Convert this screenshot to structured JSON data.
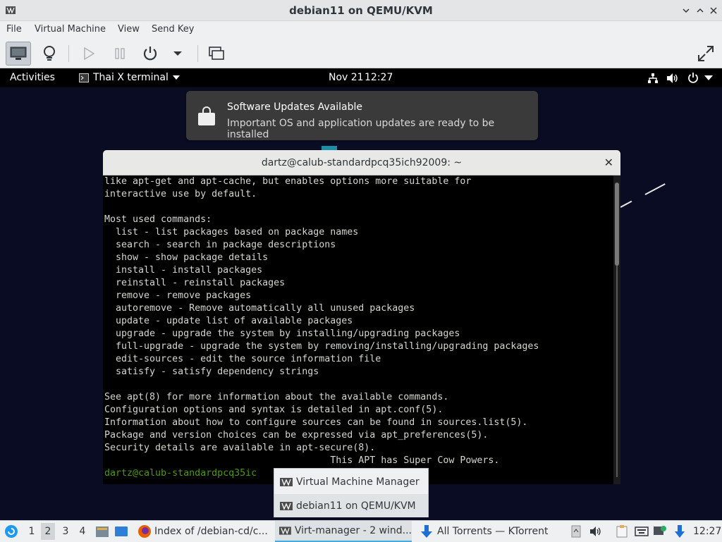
{
  "window": {
    "title": "debian11 on QEMU/KVM",
    "app_icon": "virt-manager-icon",
    "buttons": [
      "minimize-icon",
      "maximize-icon",
      "close-icon"
    ]
  },
  "menu": {
    "items": [
      "File",
      "Virtual Machine",
      "View",
      "Send Key"
    ]
  },
  "toolbar": {
    "buttons": [
      {
        "name": "console-icon",
        "active": true
      },
      {
        "name": "lightbulb-icon",
        "active": false
      },
      {
        "name": "play-icon",
        "active": false
      },
      {
        "name": "pause-icon",
        "active": false
      },
      {
        "name": "power-icon",
        "active": false
      },
      {
        "name": "chevron-down-icon",
        "active": false
      },
      {
        "name": "screenshot-icon",
        "active": false
      },
      {
        "name": "fullscreen-icon",
        "active": false
      }
    ]
  },
  "gnome": {
    "activities": "Activities",
    "app_menu": "Thai X terminal",
    "date": "Nov 21",
    "time": "12:27"
  },
  "notification": {
    "title": "Software Updates Available",
    "body": "Important OS and application updates are ready to be installed"
  },
  "terminal": {
    "title": "dartz@calub-standardpcq35ich92009: ~",
    "lines": [
      "like apt-get and apt-cache, but enables options more suitable for",
      "interactive use by default.",
      "",
      "Most used commands:",
      "  list - list packages based on package names",
      "  search - search in package descriptions",
      "  show - show package details",
      "  install - install packages",
      "  reinstall - reinstall packages",
      "  remove - remove packages",
      "  autoremove - Remove automatically all unused packages",
      "  update - update list of available packages",
      "  upgrade - upgrade the system by installing/upgrading packages",
      "  full-upgrade - upgrade the system by removing/installing/upgrading packages",
      "  edit-sources - edit the source information file",
      "  satisfy - satisfy dependency strings",
      "",
      "See apt(8) for more information about the available commands.",
      "Configuration options and syntax is detailed in apt.conf(5).",
      "Information about how to configure sources can be found in sources.list(5).",
      "Package and version choices can be expressed via apt_preferences(5).",
      "Security details are available in apt-secure(8).",
      "                                        This APT has Super Cow Powers."
    ],
    "prompt": "dartz@calub-standardpcq35ic"
  },
  "popup": {
    "items": [
      "Virtual Machine Manager",
      "debian11 on QEMU/KVM"
    ]
  },
  "taskbar": {
    "desktops": [
      "1",
      "2",
      "3",
      "4"
    ],
    "active_desktop": "2",
    "tasks": [
      "Index of /debian-cd/c...",
      "Virt-manager - 2 wind...",
      "All Torrents — KTorrent"
    ],
    "clock": "12:27"
  }
}
